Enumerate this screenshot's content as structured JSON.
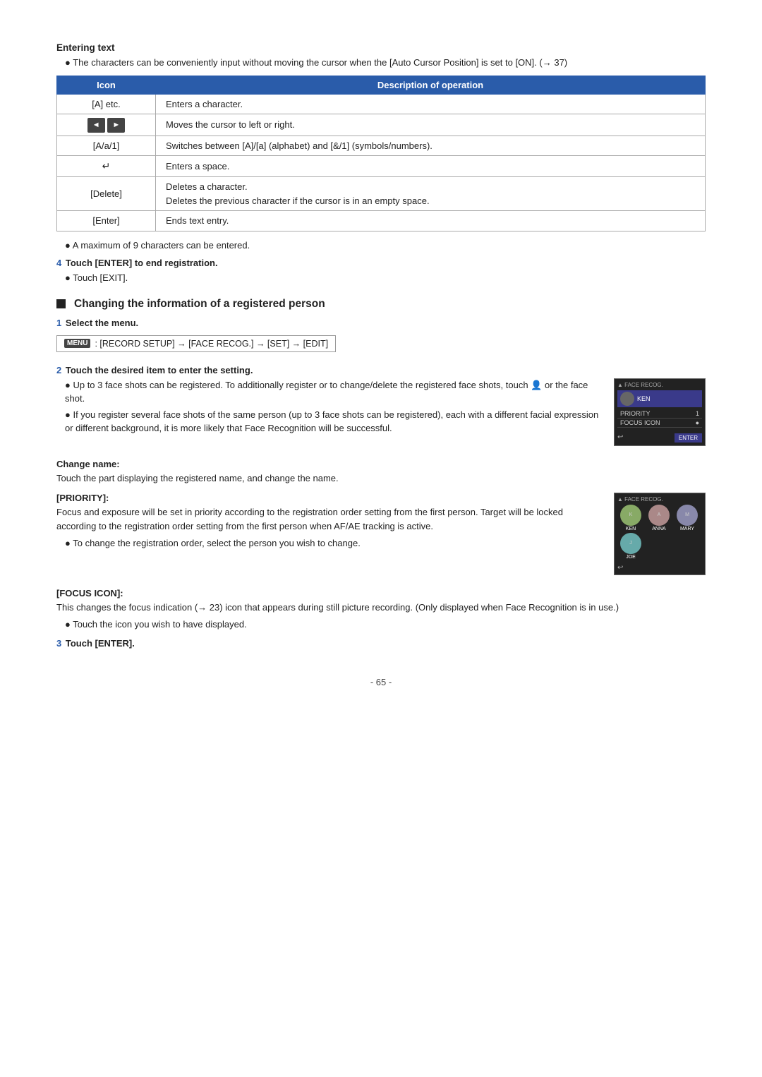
{
  "entering_text_heading": "Entering text",
  "bullet1": "The characters can be conveniently input without moving the cursor when the [Auto Cursor Position] is set to [ON]. (→ 37)",
  "table": {
    "col1": "Icon",
    "col2": "Description of operation",
    "rows": [
      {
        "icon": "[A] etc.",
        "desc": "Enters a character."
      },
      {
        "icon": "arrows",
        "desc": "Moves the cursor to left or right."
      },
      {
        "icon": "[A/a/1]",
        "desc": "Switches between [A]/[a] (alphabet) and [&/1] (symbols/numbers)."
      },
      {
        "icon": "return",
        "desc": "Enters a space."
      },
      {
        "icon": "[Delete]",
        "desc": "Deletes a character.\nDeletes the previous character if the cursor is in an empty space."
      },
      {
        "icon": "[Enter]",
        "desc": "Ends text entry."
      }
    ]
  },
  "max_chars_note": "A maximum of 9 characters can be entered.",
  "step4_label": "4",
  "step4_text": "Touch [ENTER] to end registration.",
  "step4_bullet": "Touch [EXIT].",
  "section_heading": "Changing the information of a registered person",
  "step1_label": "1",
  "step1_text": "Select the menu.",
  "menu_tag": "MENU",
  "menu_path": ": [RECORD SETUP] → [FACE RECOG.] → [SET] → [EDIT]",
  "step2_label": "2",
  "step2_text": "Touch the desired item to enter the setting.",
  "bullet_3shots": "Up to 3 face shots can be registered. To additionally register or to change/delete the registered face shots, touch  or the face shot.",
  "bullet_several": "If you register several face shots of the same person (up to 3 face shots can be registered), each with a different facial expression or different background, it is more likely that Face Recognition will be successful.",
  "change_name_heading": "Change name:",
  "change_name_text": "Touch the part displaying the registered name, and change the name.",
  "priority_heading": "[PRIORITY]:",
  "priority_text": "Focus and exposure will be set in priority according to the registration order setting from the first person. Target will be locked according to the registration order setting from the first person when AF/AE tracking is active.",
  "priority_bullet1": "To change the registration order, select the person you wish to change.",
  "focus_icon_heading": "[FOCUS ICON]:",
  "focus_icon_text": "This changes the focus indication (→ 23) icon that appears during still picture recording. (Only displayed when Face Recognition is in use.)",
  "focus_icon_bullet": "Touch the icon you wish to have displayed.",
  "step3_label": "3",
  "step3_text": "Touch [ENTER].",
  "page_number": "- 65 -",
  "face_recog_box1": {
    "title": "FACE RECOG.",
    "name": "KEN",
    "rows": [
      {
        "label": "PRIORITY",
        "value": "1"
      },
      {
        "label": "FOCUS ICON",
        "value": "●"
      }
    ],
    "enter_btn": "ENTER",
    "back_icon": "↩"
  },
  "face_recog_box2": {
    "title": "FACE RECOG.",
    "persons": [
      {
        "name": "KEN"
      },
      {
        "name": "ANNA"
      },
      {
        "name": "MARY"
      },
      {
        "name": "JOE"
      }
    ],
    "back_icon": "↩"
  }
}
